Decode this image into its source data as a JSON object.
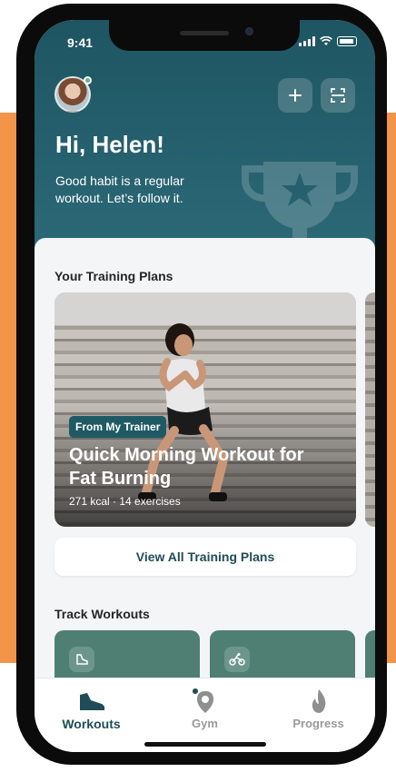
{
  "status": {
    "time": "9:41"
  },
  "header": {
    "greeting": "Hi, Helen!",
    "subtitle": "Good habit is a regular workout. Let’s follow it."
  },
  "training": {
    "section_title": "Your Training Plans",
    "card": {
      "badge": "From My Trainer",
      "title": "Quick Morning Workout for Fat Burning",
      "meta": "271 kcal · 14 exercises"
    },
    "view_all_label": "View All Training Plans"
  },
  "track": {
    "section_title": "Track Workouts",
    "cards": [
      {
        "icon": "running-shoe-icon"
      },
      {
        "icon": "cycling-icon"
      }
    ]
  },
  "tabs": [
    {
      "label": "Workouts",
      "icon": "sneaker-icon",
      "active": true
    },
    {
      "label": "Gym",
      "icon": "location-pin-icon",
      "active": false
    },
    {
      "label": "Progress",
      "icon": "flame-icon",
      "active": false
    }
  ],
  "colors": {
    "header": "#1E5562",
    "accent": "#1F5A64",
    "track_card": "#4E7F72",
    "background": "#F39548"
  }
}
